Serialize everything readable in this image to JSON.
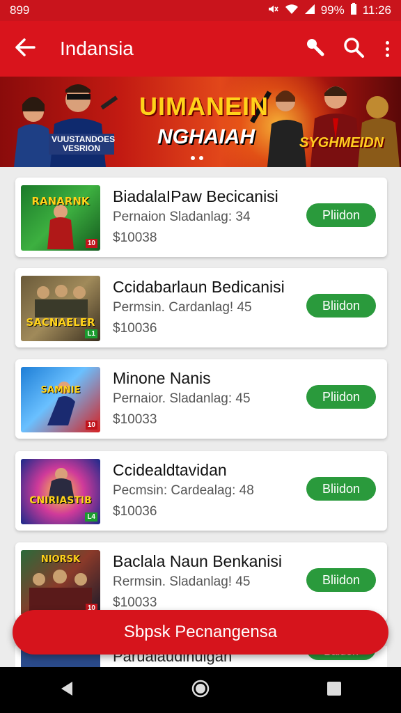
{
  "status": {
    "left_text": "899",
    "battery": "99%",
    "time": "11:26"
  },
  "appbar": {
    "title": "Indansia"
  },
  "banner": {
    "headline": "UIMANEIN",
    "sub": "NGHAIAH",
    "tag_left": "VUUSTANDOES VESRION",
    "tag_right": "SYGHMEIDN"
  },
  "items": [
    {
      "name": "BiadalaIPaw Becicanisi",
      "meta": "Pernaion Sladanlag: 34",
      "price": "$10038",
      "button": "Pliidon",
      "thumb_label": "RANARNK",
      "thumb_badge": "10"
    },
    {
      "name": "Ccidabarlaun Bedicanisi",
      "meta": "Permsin. Cardanlag! 45",
      "price": "$10036",
      "button": "Bliidon",
      "thumb_label": "SACNAELER",
      "thumb_badge": "L1"
    },
    {
      "name": "Minone Nanis",
      "meta": "Pernaior. Sladanlag: 45",
      "price": "$10033",
      "button": "Pliidon",
      "thumb_label": "SAMNIE",
      "thumb_badge": "10"
    },
    {
      "name": "Ccidealdtavidan",
      "meta": "Pecmsin: Cardealag: 48",
      "price": "$10036",
      "button": "Bliidon",
      "thumb_label": "CNIRIASTIB",
      "thumb_badge": "L4"
    },
    {
      "name": "Baclala Naun Benkanisi",
      "meta": "Rermsin. Sladanlag! 45",
      "price": "$10033",
      "button": "Bliidon",
      "thumb_label": "NIORSK",
      "thumb_badge": "10"
    }
  ],
  "peek_item": {
    "name": "Parualaudinuigan",
    "button": "Baidon"
  },
  "fab": {
    "label": "Sbpsk Pecnangensa"
  },
  "colors": {
    "primary": "#d9141c",
    "button": "#2a9a3c"
  }
}
